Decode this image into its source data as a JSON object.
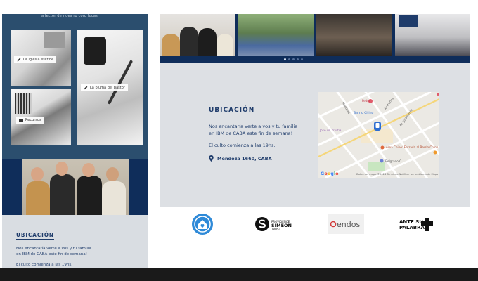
{
  "mobile": {
    "top_text": "a  lector  de  nues  ro  coro  lucas",
    "cards": [
      {
        "label": "La iglesia escribe",
        "icon": "pencil-icon"
      },
      {
        "label": "La pluma del pastor",
        "icon": "pencil-icon"
      },
      {
        "label": "Recursos",
        "icon": "folder-icon"
      }
    ],
    "location": {
      "heading": "UBICACIÓN",
      "text": "Nos encantaría verte a vos y tu familia en IBM de CABA este fin de semana!",
      "cut_text": "El culto comienza a las 19hs."
    }
  },
  "desktop": {
    "location": {
      "heading": "UBICACIÓN",
      "text": "Nos encantaría verte a vos y tu familia en IBM de CABA este fin de semana!",
      "service_time": "El culto comienza a las 19hs.",
      "address": "Mendoza 1660, CABA",
      "address_icon": "map-pin-icon"
    },
    "map": {
      "labels": [
        "Fedra",
        "Barrio Chino",
        "Area Chino: Entrada al Barrio Chino",
        "Belgrano C",
        "José de Yrurtia",
        "Arribeños",
        "Av. Juramento",
        "Mendoza"
      ],
      "google": "Google",
      "footer": "Datos del mapa ©2024   Términos   Notificar un problema de Maps"
    },
    "partners": [
      {
        "name": "logo-1",
        "icon": "home-heart-icon"
      },
      {
        "name": "Simeon Trust",
        "icon": "simeon-logo"
      },
      {
        "name": "endos",
        "icon": "endos-logo"
      },
      {
        "name": "ANTE SU PALABRA",
        "icon": "ante-su-palabra-logo"
      }
    ],
    "slider_dots": 5,
    "slider_active": 0
  },
  "colors": {
    "navy": "#0f2d5a",
    "heading_blue": "#1f3c6b",
    "panel_gray": "#dde0e4",
    "mobile_bg": "#2b4e6e"
  }
}
